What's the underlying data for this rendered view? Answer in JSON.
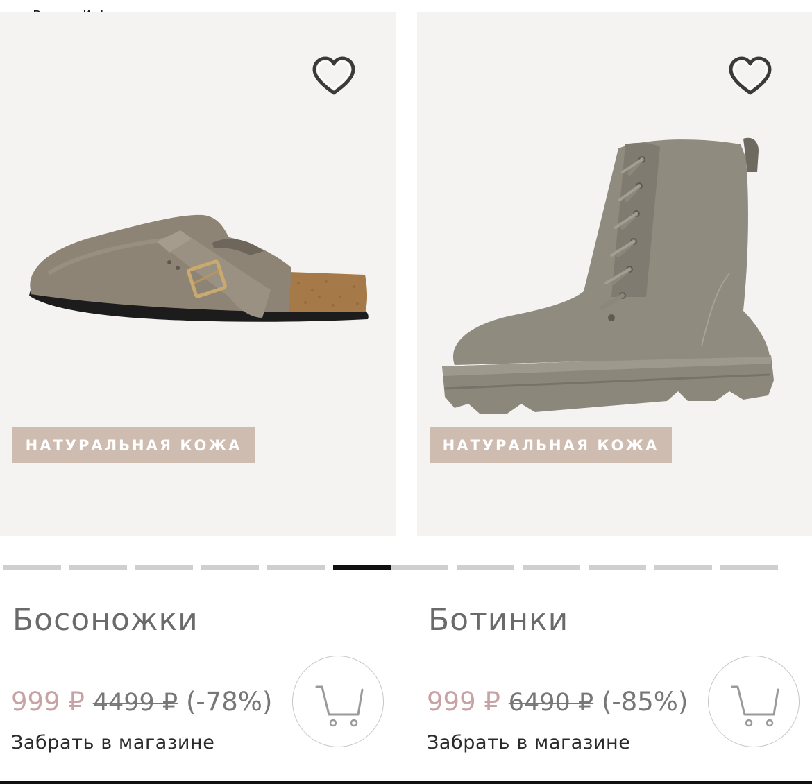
{
  "ad_notice": "Реклама. Информация о рекламодателе по ссылке",
  "products": [
    {
      "title": "Босоножки",
      "badge": "НАТУРАЛЬНАЯ КОЖА",
      "price_current": "999 ₽",
      "price_old": "4499 ₽",
      "discount": "(-78%)",
      "pickup": "Забрать в магазине",
      "image": "suede-clog-icon"
    },
    {
      "title": "Ботинки",
      "badge": "НАТУРАЛЬНАЯ КОЖА",
      "price_current": "999 ₽",
      "price_old": "6490 ₽",
      "discount": "(-85%)",
      "pickup": "Забрать в магазине",
      "image": "lace-up-boot-icon"
    }
  ],
  "carousel": {
    "total_slides": 12,
    "active_slide": 5
  },
  "icons": {
    "favorite": "heart-icon",
    "cart": "cart-icon"
  },
  "colors": {
    "card_bg": "#f4f3f2",
    "badge_bg": "#cdbcaf",
    "price_current": "#c7a3a6",
    "text_muted": "#777777",
    "pager_active": "#111111",
    "pager_inactive": "#cfcfcf"
  }
}
